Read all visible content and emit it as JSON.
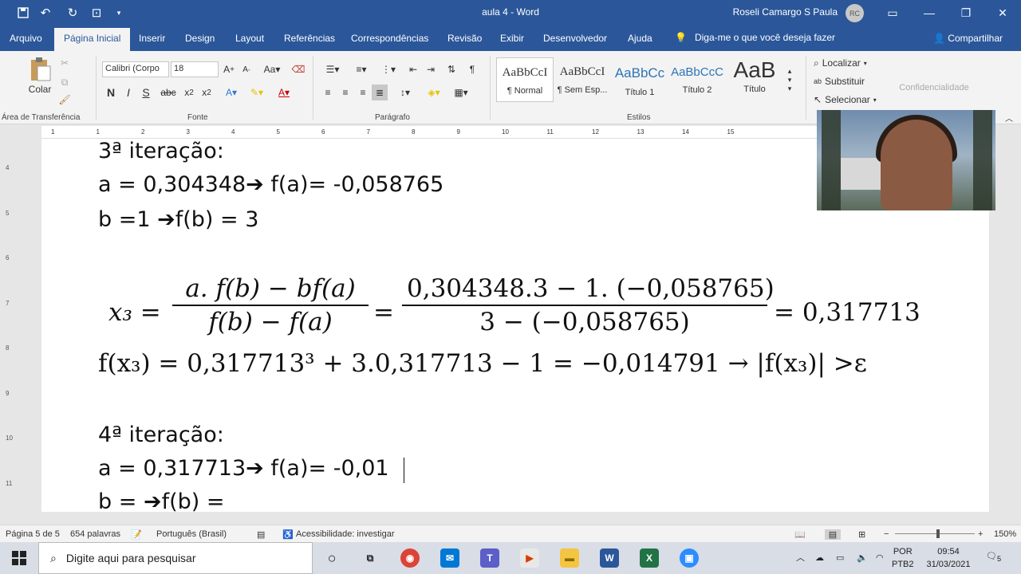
{
  "window": {
    "title": "aula 4  -  Word",
    "user_name": "Roseli Camargo S Paula",
    "user_initials": "RC"
  },
  "tabs": [
    {
      "label": "Arquivo"
    },
    {
      "label": "Página Inicial"
    },
    {
      "label": "Inserir"
    },
    {
      "label": "Design"
    },
    {
      "label": "Layout"
    },
    {
      "label": "Referências"
    },
    {
      "label": "Correspondências"
    },
    {
      "label": "Revisão"
    },
    {
      "label": "Exibir"
    },
    {
      "label": "Desenvolvedor"
    },
    {
      "label": "Ajuda"
    }
  ],
  "tell_me": "Diga-me o que você deseja fazer",
  "share_label": "Compartilhar",
  "ribbon": {
    "paste_label": "Colar",
    "font_name": "Calibri (Corpo",
    "font_size": "18",
    "bold": "N",
    "italic": "I",
    "underline": "S",
    "styles": [
      {
        "preview": "AaBbCcI",
        "name": "¶ Normal"
      },
      {
        "preview": "AaBbCcI",
        "name": "¶ Sem Esp..."
      },
      {
        "preview": "AaBbCc",
        "name": "Título 1"
      },
      {
        "preview": "AaBbCcC",
        "name": "Título 2"
      },
      {
        "preview": "AaB",
        "name": "Título"
      }
    ],
    "editing": {
      "find": "Localizar",
      "replace": "Substituir",
      "select": "Selecionar"
    },
    "sensitivity": "Confidencialidade",
    "groups": {
      "clipboard": "Área de Transferência",
      "font": "Fonte",
      "paragraph": "Parágrafo",
      "styles": "Estilos"
    }
  },
  "ruler_ticks": [
    "1",
    "1",
    "2",
    "3",
    "4",
    "5",
    "6",
    "7",
    "8",
    "9",
    "10",
    "11",
    "12",
    "13",
    "14",
    "15"
  ],
  "vruler_ticks": [
    "4",
    "5",
    "6",
    "7",
    "8",
    "9",
    "10",
    "11"
  ],
  "document": {
    "iter3_title": "3ª iteração:",
    "iter3_a": "a = 0,304348",
    "iter3_fa": "f(a)= -0,058765",
    "iter3_b": "b =1 ",
    "iter3_fb": "f(b) = 3",
    "eq1_lhs": "x₃ =",
    "eq1_frac1_num": "a. f(b) − bf(a)",
    "eq1_frac1_den": "f(b) − f(a)",
    "eq1_eq": "=",
    "eq1_frac2_num": "0,304348.3 − 1. (−0,058765)",
    "eq1_frac2_den": "3 − (−0,058765)",
    "eq1_rhs": "= 0,317713",
    "eq2": "f(x₃) = 0,317713³ + 3.0,317713 − 1 = −0,014791 → |f(x₃)|  >ε",
    "iter4_title": "4ª iteração:",
    "iter4_a": "a = 0,317713",
    "iter4_fa": "f(a)= -0,01",
    "iter4_b": "b = ",
    "iter4_fb": "f(b) ="
  },
  "status": {
    "page": "Página 5 de 5",
    "words": "654 palavras",
    "language": "Português (Brasil)",
    "accessibility": "Acessibilidade: investigar",
    "zoom": "150%"
  },
  "taskbar": {
    "search_placeholder": "Digite aqui para pesquisar",
    "lang_top": "POR",
    "lang_bottom": "PTB2",
    "time": "09:54",
    "date": "31/03/2021",
    "notifications": "5"
  },
  "colors": {
    "accent": "#2b579a",
    "document_text": "#111111"
  }
}
